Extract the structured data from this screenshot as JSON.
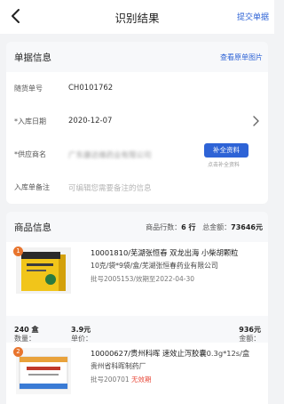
{
  "nav": {
    "title": "识别结果",
    "submit_label": "提交单据"
  },
  "receipt_card": {
    "title": "单据信息",
    "view_image_label": "查看原单图片",
    "rows": {
      "delivery_no": {
        "label": "随货单号",
        "value": "CH0101762"
      },
      "warehouse_date": {
        "label": "*入库日期",
        "value": "2020-12-07"
      },
      "supplier": {
        "label": "*供应商名",
        "value": "广东康达维药业有限公司",
        "fill_button": "补全资料",
        "fill_hint": "点击补全资料"
      },
      "remark": {
        "label": "入库单备注",
        "placeholder": "可编辑您需要备注的信息"
      }
    }
  },
  "goods_card": {
    "title": "商品信息",
    "row_count_label": "商品行数：",
    "row_count_value": "6 行",
    "total_label": "总金额：",
    "total_value": "73646元",
    "items": [
      {
        "index": "1",
        "name": "10001810/芜湖张恒春 双龙出海 小柴胡颗粒",
        "spec": "10克/袋*9袋/盒/芜湖张恒春药业有限公司",
        "batch": "批号2005153/效期至2022-04-30",
        "qty_label": "数量：",
        "qty_value": "240 盒",
        "price_label": "单价：",
        "price_value": "3.9元",
        "amount_label": "金额：",
        "amount_value": "936元"
      },
      {
        "index": "2",
        "name": "10000627/贵州科晖 速效止泻胶囊",
        "spec_suffix": "0.3g*12s/盒",
        "spec": "贵州省科晖制药厂",
        "batch": "批号200701",
        "batch_warning": "无效期"
      }
    ]
  },
  "colors": {
    "accent": "#2e63d6",
    "badge": "#e8742d",
    "warning": "#e84b3c",
    "page_bg": "#f2f3f5"
  },
  "icons": {
    "back": "chevron-left-icon",
    "row_arrow": "chevron-right-icon"
  }
}
